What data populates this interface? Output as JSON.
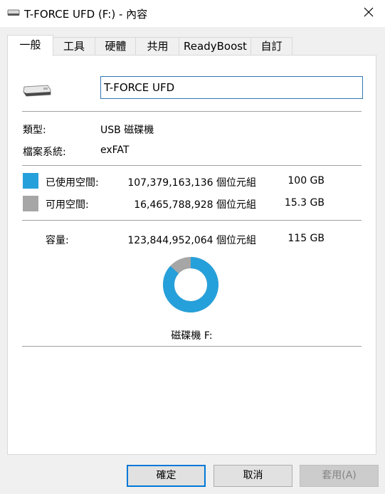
{
  "window": {
    "title": "T-FORCE UFD (F:) - 內容"
  },
  "tabs": [
    {
      "label": "一般"
    },
    {
      "label": "工具"
    },
    {
      "label": "硬體"
    },
    {
      "label": "共用"
    },
    {
      "label": "ReadyBoost"
    },
    {
      "label": "自訂"
    }
  ],
  "drive": {
    "name": "T-FORCE UFD",
    "icon": "usb-drive-icon"
  },
  "info": {
    "type_label": "類型:",
    "type_value": "USB 磁碟機",
    "fs_label": "檔案系統:",
    "fs_value": "exFAT"
  },
  "space": {
    "used": {
      "label": "已使用空間:",
      "bytes": "107,379,163,136 個位元組",
      "size": "100 GB",
      "color": "#26a0da"
    },
    "free": {
      "label": "可用空間:",
      "bytes": "16,465,788,928 個位元組",
      "size": "15.3 GB",
      "color": "#a6a6a6"
    },
    "capacity": {
      "label": "容量:",
      "bytes": "123,844,952,064 個位元組",
      "size": "115 GB"
    },
    "used_fraction": 0.867
  },
  "chart_label": "磁碟機 F:",
  "buttons": {
    "ok": "確定",
    "cancel": "取消",
    "apply": "套用(A)"
  }
}
